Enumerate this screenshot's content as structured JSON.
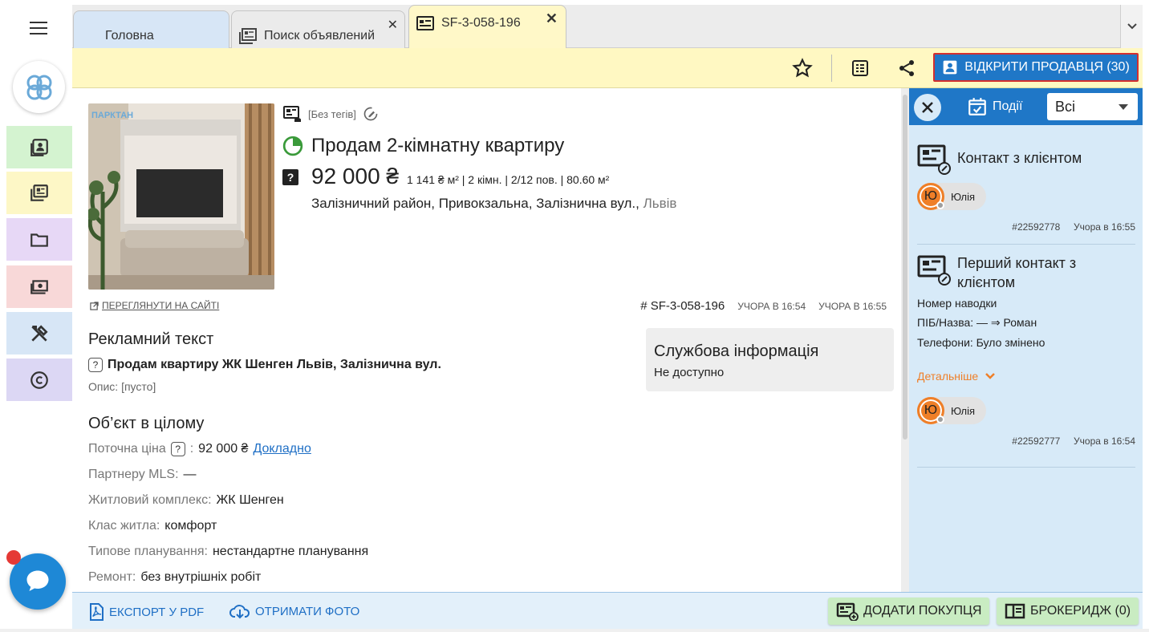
{
  "tabs": [
    {
      "label": "Головна"
    },
    {
      "label": "Поиск объявлений"
    },
    {
      "label": "SF-3-058-196"
    }
  ],
  "toolbar": {
    "open_seller_label": "ВІДКРИТИ ПРОДАВЦЯ (30)"
  },
  "listing": {
    "tags": "[Без тегів]",
    "photo_watermark": "ПАРКТАН",
    "title": "Продам 2-кімнатну квартиру",
    "price": "92 000 ₴",
    "details": "1 141 ₴ м² | 2 кімн. | 2/12 пов. | 80.60 м²",
    "address": "Залізничний район, Привокзальна, Залізнична вул.,",
    "city": "Львів",
    "view_on_site": "ПЕРЕГЛЯНУТИ НА САЙТІ",
    "id": "# SF-3-058-196",
    "created": "УЧОРА В 16:54",
    "updated": "УЧОРА В 16:55"
  },
  "ad_text": {
    "heading": "Рекламний текст",
    "headline": "Продам квартиру ЖК Шенген Львів, Залізнична вул.",
    "description": "Опис: [пусто]"
  },
  "service_info": {
    "heading": "Службова інформація",
    "value": "Не доступно"
  },
  "object": {
    "heading": "Об’єкт в цілому",
    "rows": [
      {
        "label": "Поточна ціна",
        "value": "92 000 ₴",
        "link": "Докладно"
      },
      {
        "label": "Партнеру MLS:",
        "value": "—"
      },
      {
        "label": "Житловий комплекс:",
        "value": "ЖК Шенген"
      },
      {
        "label": "Клас житла:",
        "value": "комфорт"
      },
      {
        "label": "Типове планування:",
        "value": "нестандартне планування"
      },
      {
        "label": "Ремонт:",
        "value": "без внутрішніх робіт"
      }
    ]
  },
  "events_panel": {
    "events_label": "Події",
    "filter_value": "Всі",
    "events": [
      {
        "title": "Контакт з клієнтом",
        "user_initial": "Ю",
        "user_name": "Юлія",
        "id": "#22592778",
        "time": "Учора в 16:55"
      },
      {
        "title": "Перший контакт з клієнтом",
        "lines": [
          "Номер наводки",
          "ПІБ/Назва: — ⇒ Роман",
          "Телефони: Було змінено"
        ],
        "more": "Детальніше",
        "user_initial": "Ю",
        "user_name": "Юлія",
        "id": "#22592777",
        "time": "Учора в 16:54"
      }
    ]
  },
  "bottom": {
    "export_pdf": "ЕКСПОРТ У PDF",
    "get_photo": "ОТРИМАТИ ФОТО",
    "add_buyer": "ДОДАТИ ПОКУПЦЯ",
    "brokerage": "БРОКЕРИДЖ (0)"
  },
  "colors": {
    "primary": "#1f77c7",
    "accent": "#ef7f28",
    "toolbar_bg": "#fff8c2",
    "green_btn": "#c9ecc2"
  }
}
